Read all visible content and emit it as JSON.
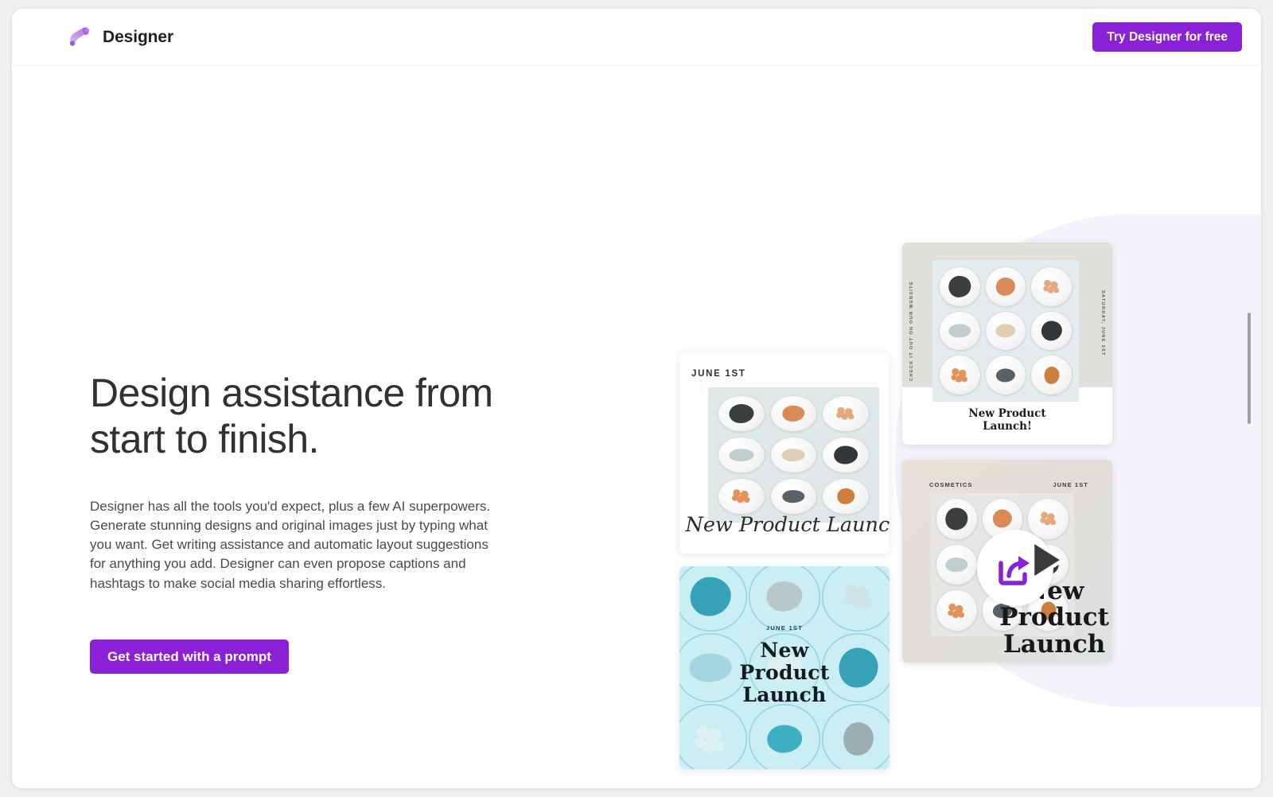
{
  "window": {
    "scrollbar": {
      "name": "vertical-scrollbar"
    }
  },
  "header": {
    "brand_name": "Designer",
    "logo_icon": "designer-brush-logo",
    "cta_label": "Try Designer for free",
    "cta_color": "#8b21d6"
  },
  "hero": {
    "title_line1": "Design assistance from",
    "title_line2": "start to finish.",
    "description": "Designer has all the tools you'd expect, plus a few AI superpowers. Generate stunning designs and original images just by typing what you want. Get writing assistance and automatic layout suggestions for anything you add. Designer can even propose captions and hashtags to make social media sharing effortless.",
    "cta_label": "Get started with a prompt",
    "cta_color": "#8b21d6"
  },
  "collage": {
    "card_a": {
      "name": "design-card-white-poster",
      "date_label": "JUNE 1ST",
      "script_title": "New Product Launch!"
    },
    "card_b": {
      "name": "design-card-grey-poster",
      "vertical_left": "CHECK IT OUT ON OUR WEBSITE",
      "vertical_right": "SATURDAY, JUNE 1ST",
      "title_line1": "New Product",
      "title_line2": "Launch!"
    },
    "card_c": {
      "name": "design-card-aqua-poster",
      "date_label": "JUNE 1ST",
      "title_line1": "New",
      "title_line2": "Product",
      "title_line3": "Launch"
    },
    "card_d": {
      "name": "design-card-video-poster",
      "tag_left": "COSMETICS",
      "tag_right": "JUNE 1ST",
      "title_line1": "New",
      "title_line2": "Product",
      "title_line3": "Launch",
      "overlay_icons": [
        "share-icon",
        "play-cursor-icon"
      ]
    }
  },
  "theme": {
    "accent": "#8b21d6",
    "blob_background": "#f5f2fb",
    "card_a_grid_bg": "#dde8e8",
    "card_b_bg": "#dfe0dc",
    "card_c_bg": "#c9eff4"
  }
}
